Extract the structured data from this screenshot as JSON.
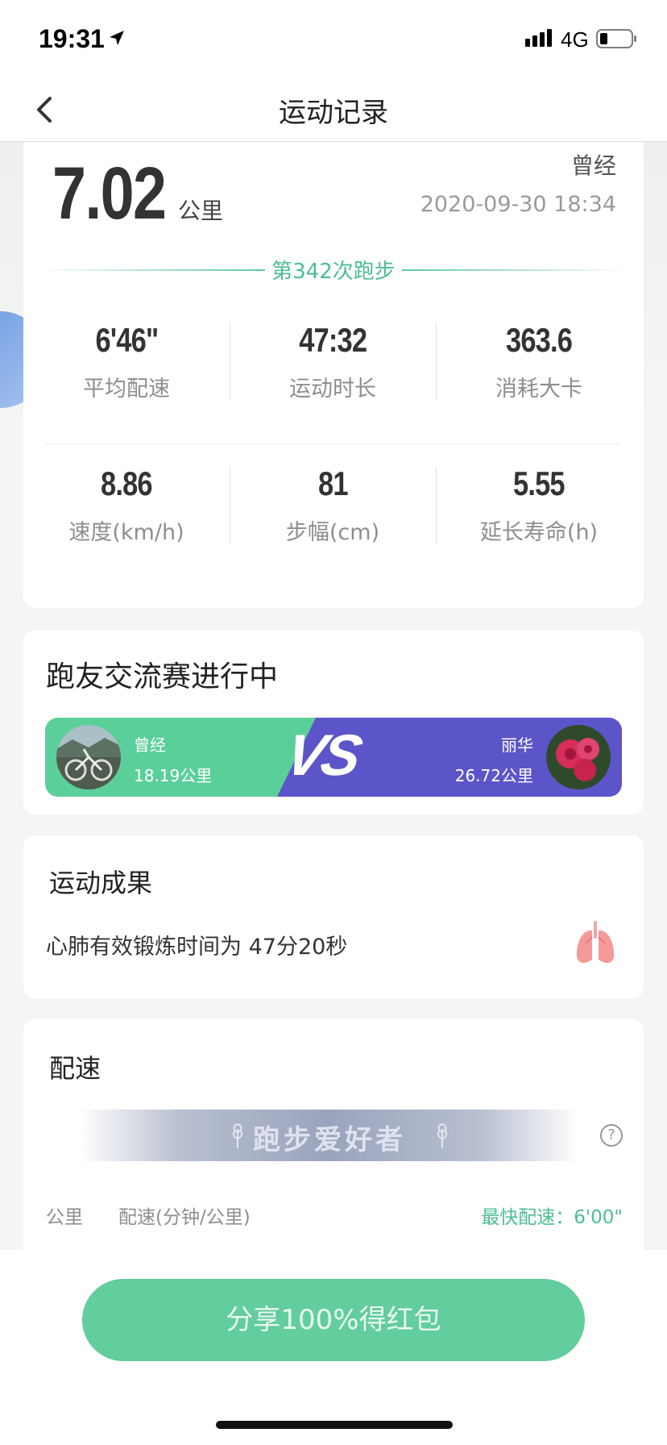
{
  "status_bar": {
    "time": "19:31",
    "network": "4G",
    "icons": [
      "location-arrow-icon",
      "signal-icon",
      "battery-icon"
    ]
  },
  "nav": {
    "title": "运动记录",
    "back_icon": "chevron-left-icon"
  },
  "run": {
    "distance": "7.02",
    "distance_unit": "公里",
    "label": "曾经",
    "datetime": "2020-09-30 18:34",
    "count_text": "第342次跑步"
  },
  "stats": {
    "pace": {
      "value": "6'46\"",
      "label": "平均配速"
    },
    "duration": {
      "value": "47:32",
      "label": "运动时长"
    },
    "calories": {
      "value": "363.6",
      "label": "消耗大卡"
    },
    "speed": {
      "value": "8.86",
      "label": "速度(km/h)"
    },
    "stride": {
      "value": "81",
      "label": "步幅(cm)"
    },
    "life": {
      "value": "5.55",
      "label": "延长寿命(h)"
    }
  },
  "contest": {
    "title": "跑友交流赛进行中",
    "vs": "VS",
    "left": {
      "name": "曾经",
      "distance": "18.19公里"
    },
    "right": {
      "name": "丽华",
      "distance": "26.72公里"
    },
    "colors": {
      "left": "#5bcf9a",
      "right": "#5c55c9"
    }
  },
  "result": {
    "title": "运动成果",
    "text": "心肺有效锻炼时间为 47分20秒",
    "icon": "lungs-icon"
  },
  "pace_section": {
    "title": "配速",
    "banner": "跑步爱好者",
    "help": "?",
    "col_km": "公里",
    "col_pace": "配速(分钟/公里)",
    "fastest": "最快配速：6'00\""
  },
  "share": {
    "label": "分享100%得红包",
    "color": "#62cd9d"
  }
}
